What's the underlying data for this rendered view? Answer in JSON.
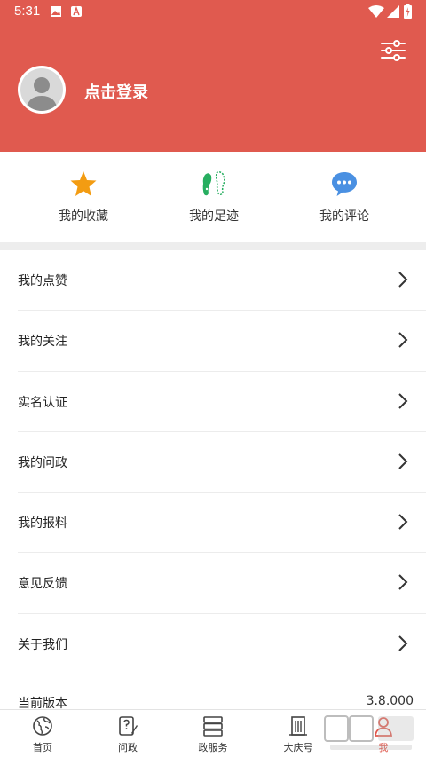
{
  "statusbar": {
    "time": "5:31"
  },
  "header": {
    "login_text": "点击登录"
  },
  "quick_actions": [
    {
      "label": "我的收藏",
      "icon": "star-icon"
    },
    {
      "label": "我的足迹",
      "icon": "footprints-icon"
    },
    {
      "label": "我的评论",
      "icon": "comment-icon"
    }
  ],
  "menu": [
    {
      "label": "我的点赞"
    },
    {
      "label": "我的关注"
    },
    {
      "label": "实名认证"
    },
    {
      "label": "我的问政"
    },
    {
      "label": "我的报料"
    },
    {
      "label": "意见反馈"
    },
    {
      "label": "关于我们"
    }
  ],
  "version": {
    "label": "当前版本",
    "value": "3.8.000"
  },
  "tabs": [
    {
      "label": "首页",
      "icon": "globe-icon"
    },
    {
      "label": "问政",
      "icon": "question-pen-icon"
    },
    {
      "label": "政服务",
      "icon": "server-icon"
    },
    {
      "label": "大庆号",
      "icon": "building-icon"
    },
    {
      "label": "我",
      "icon": "person-icon"
    }
  ],
  "colors": {
    "accent": "#e05a4f",
    "star": "#f39c12",
    "footprint": "#27ae60",
    "comment": "#4a90e2"
  }
}
